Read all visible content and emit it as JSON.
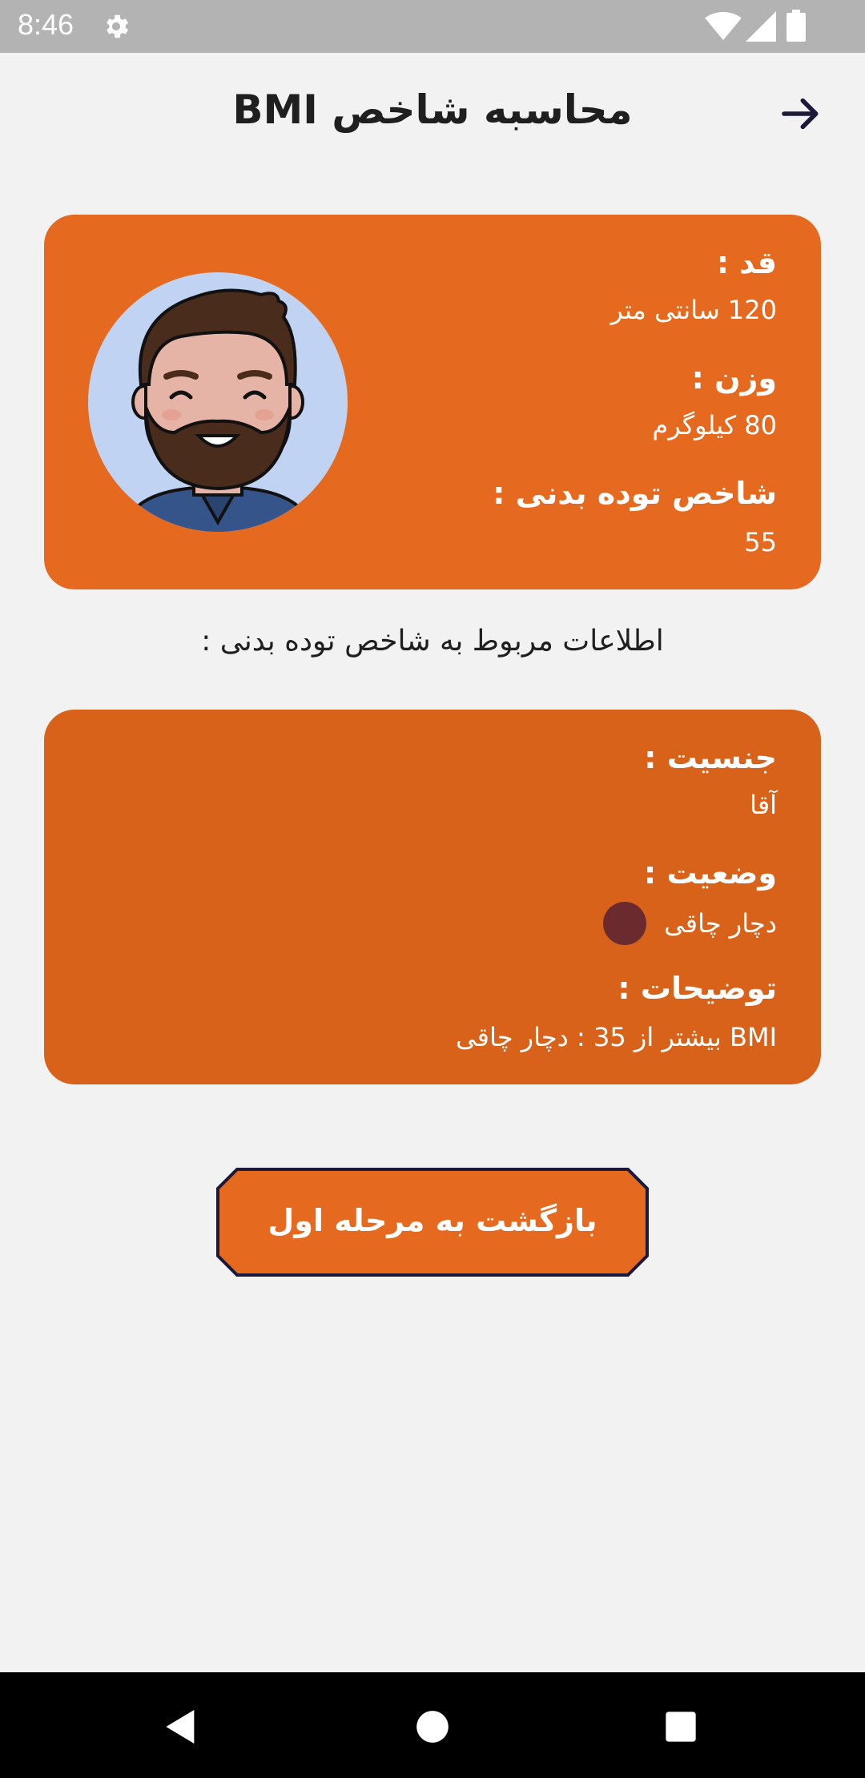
{
  "status_bar": {
    "time": "8:46",
    "icons": [
      "gear-icon",
      "wifi-icon",
      "signal-icon",
      "battery-icon"
    ]
  },
  "header": {
    "title": "محاسبه شاخص BMI",
    "back_icon": "arrow-right-icon"
  },
  "summary_card": {
    "color": "#e5691f",
    "height_label": "قد :",
    "height_value": "120 سانتی متر",
    "weight_label": "وزن :",
    "weight_value": "80 کیلوگرم",
    "bmi_label": "شاخص توده بدنی :",
    "bmi_value": "55",
    "avatar": "bearded-man-avatar"
  },
  "section_title": "اطلاعات مربوط به شاخص توده بدنی :",
  "info_card": {
    "color": "#d9621a",
    "gender_label": "جنسیت :",
    "gender_value": "آقا",
    "status_label": "وضعیت :",
    "status_value": "دچار چاقی",
    "status_color": "#6b2a2e",
    "description_label": "توضیحات :",
    "description_value": "BMI بیشتر از 35 : دچار چاقی"
  },
  "button": {
    "label": "بازگشت به مرحله اول",
    "color": "#e5691f",
    "border_color": "#1b1a3a"
  },
  "nav_bar": {
    "icons": [
      "back-triangle-icon",
      "home-circle-icon",
      "recents-square-icon"
    ]
  }
}
